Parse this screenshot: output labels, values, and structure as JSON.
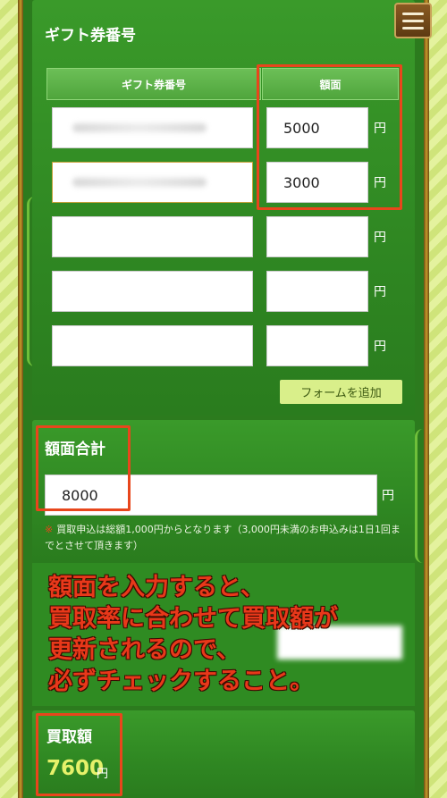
{
  "header": {
    "menu_icon": "hamburger-menu-icon"
  },
  "gift_section": {
    "title": "ギフト券番号",
    "col_code_header": "ギフト券番号",
    "col_amount_header": "額面",
    "rows": [
      {
        "code": "",
        "amount": "5000",
        "yen": "円"
      },
      {
        "code": "",
        "amount": "3000",
        "yen": "円"
      },
      {
        "code": "",
        "amount": "",
        "yen": "円"
      },
      {
        "code": "",
        "amount": "",
        "yen": "円"
      },
      {
        "code": "",
        "amount": "",
        "yen": "円"
      }
    ],
    "add_form_label": "フォームを追加"
  },
  "total_section": {
    "title": "額面合計",
    "value": "8000",
    "yen": "円",
    "note_mark": "※",
    "note": "買取申込は総額1,000円からとなります（3,000円未満のお申込みは1日1回までとさせて頂きます）"
  },
  "annotation": {
    "lines": [
      "額面を入力すると、",
      "買取率に合わせて買取額が",
      "更新されるので、",
      "必ずチェックすること。"
    ]
  },
  "purchase_section": {
    "title": "買取額",
    "value": "7600",
    "yen": "円"
  },
  "colors": {
    "panel_green": "#2f8722",
    "highlight_red": "#e8461c",
    "add_button_bg": "#d9ef8a",
    "price_yellow": "#e6f16a"
  }
}
